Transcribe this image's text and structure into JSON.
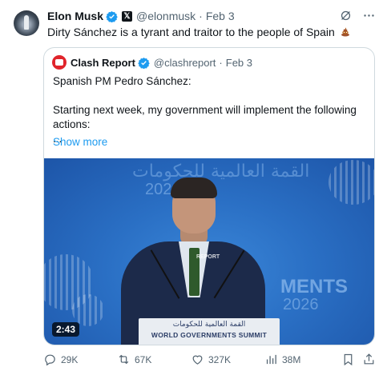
{
  "post": {
    "author_name": "Elon Musk",
    "author_handle": "@elonmusk",
    "separator": "·",
    "date": "Feb 3",
    "text": "Dirty Sánchez is a tyrant and traitor to the people of Spain",
    "emoji": "pile-of-poo",
    "badges": [
      "verified-icon",
      "x-affiliate-badge"
    ]
  },
  "quote": {
    "author_name": "Clash Report",
    "author_handle": "@clashreport",
    "separator": "·",
    "date": "Feb 3",
    "text": "Spanish PM Pedro Sánchez:\n\nStarting next week, my government will implement the following actions:\n...",
    "show_more": "Show more",
    "media": {
      "duration": "2:43",
      "backdrop_arabic": "القمة العالمية للحكومات",
      "backdrop_year": "2026",
      "backdrop_en": "MENTS",
      "backdrop_year_right": "2026",
      "podium_arabic": "القمة العالمية للحكومات",
      "podium_en": "WORLD GOVERNMENTS SUMMIT",
      "watermark": "REPORT"
    }
  },
  "actions": {
    "replies": "29K",
    "reposts": "67K",
    "likes": "327K",
    "views": "38M"
  },
  "colors": {
    "accent": "#1d9bf0",
    "muted": "#536471",
    "border": "#cfd9de"
  }
}
